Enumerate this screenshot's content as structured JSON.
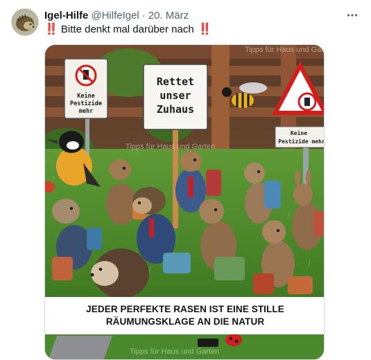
{
  "tweet": {
    "display_name": "Igel-Hilfe",
    "handle": "@HilfeIgel",
    "separator": "·",
    "date": "20. März",
    "text_marker": "‼️",
    "text": "Bitte denkt mal darüber nach",
    "more_icon": "ellipsis-horizontal-icon"
  },
  "image": {
    "sign_center": [
      "Rettet",
      "unser",
      "Zuhaus"
    ],
    "sign_left": [
      "Keine",
      "Pestizide",
      "mehr"
    ],
    "sign_right": [
      "Keine",
      "Pestizide mehr"
    ],
    "watermark_top": "Tipps für Haus und Garten",
    "watermark_mid": "Tipps für Haus und Garten",
    "watermark_bottom": "Tipps für Haus und Garten",
    "caption_line1": "JEDER PERFEKTE RASEN IST EINE STILLE",
    "caption_line2": "RÄUMUNGSKLAGE AN DIE NATUR"
  },
  "colors": {
    "text_primary": "#0f1419",
    "text_secondary": "#536471",
    "bang_red": "#e0102c",
    "border": "#cfd9de",
    "grass": "#4f8a2e"
  }
}
